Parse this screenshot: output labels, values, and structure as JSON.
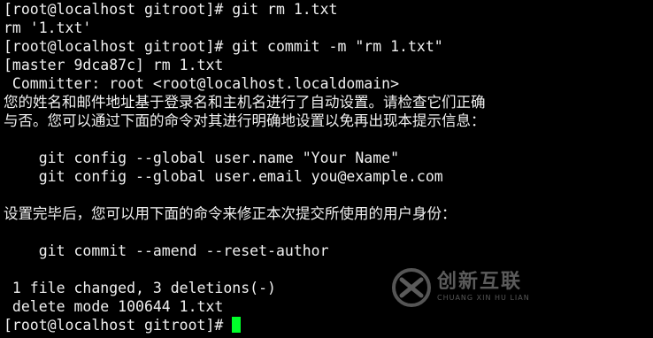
{
  "terminal": {
    "lines": [
      "[root@localhost gitroot]# git rm 1.txt",
      "rm '1.txt'",
      "[root@localhost gitroot]# git commit -m \"rm 1.txt\"",
      "[master 9dca87c] rm 1.txt",
      " Committer: root <root@localhost.localdomain>",
      "您的姓名和邮件地址基于登录名和主机名进行了自动设置。请检查它们正确",
      "与否。您可以通过下面的命令对其进行明确地设置以免再出现本提示信息：",
      "",
      "    git config --global user.name \"Your Name\"",
      "    git config --global user.email you@example.com",
      "",
      "设置完毕后，您可以用下面的命令来修正本次提交所使用的用户身份：",
      "",
      "    git commit --amend --reset-author",
      "",
      " 1 file changed, 3 deletions(-)",
      " delete mode 100644 1.txt"
    ],
    "prompt": "[root@localhost gitroot]# ",
    "colors": {
      "background": "#000000",
      "foreground": "#f0f0f0",
      "cursor": "#00ff2a"
    }
  },
  "watermark": {
    "cn": "创新互联",
    "en": "CHUANG XIN HU LIAN"
  }
}
